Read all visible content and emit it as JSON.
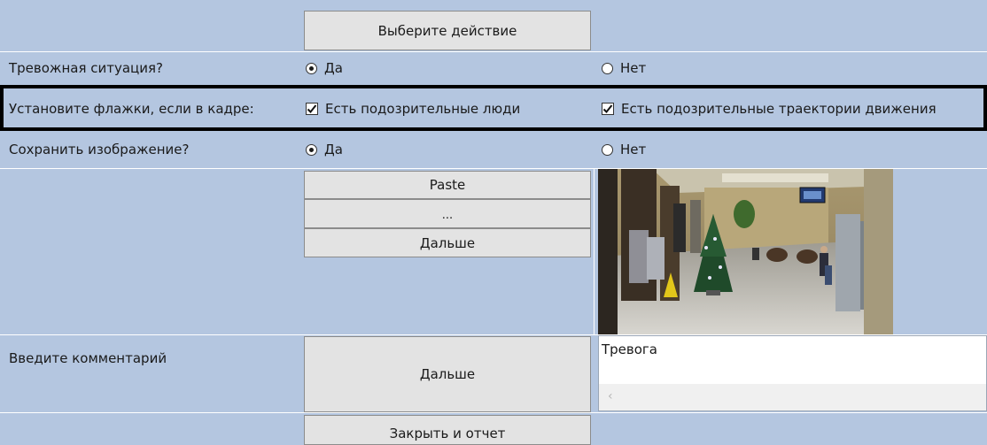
{
  "action_row": {
    "button_label": "Выберите действие"
  },
  "alarm_row": {
    "label": "Тревожная ситуация?",
    "options": [
      {
        "label": "Да",
        "checked": true
      },
      {
        "label": "Нет",
        "checked": false
      }
    ]
  },
  "flags_row": {
    "label": "Установите флажки, если в кадре:",
    "checkboxes": [
      {
        "label": "Есть подозрительные люди",
        "checked": true
      },
      {
        "label": "Есть подозрительные траектории движения",
        "checked": true
      }
    ]
  },
  "save_row": {
    "label": "Сохранить изображение?",
    "options": [
      {
        "label": "Да",
        "checked": true
      },
      {
        "label": "Нет",
        "checked": false
      }
    ]
  },
  "image_row": {
    "paste_label": "Paste",
    "browse_label": "...",
    "next_label": "Дальше"
  },
  "comment_row": {
    "label": "Введите комментарий",
    "next_label": "Дальше",
    "comment_value": "Тревога"
  },
  "bottom_row": {
    "button_label": "Закрыть и отчет"
  },
  "colors": {
    "background": "#b4c6e0",
    "button": "#e3e3e3",
    "frame": "#000000"
  }
}
